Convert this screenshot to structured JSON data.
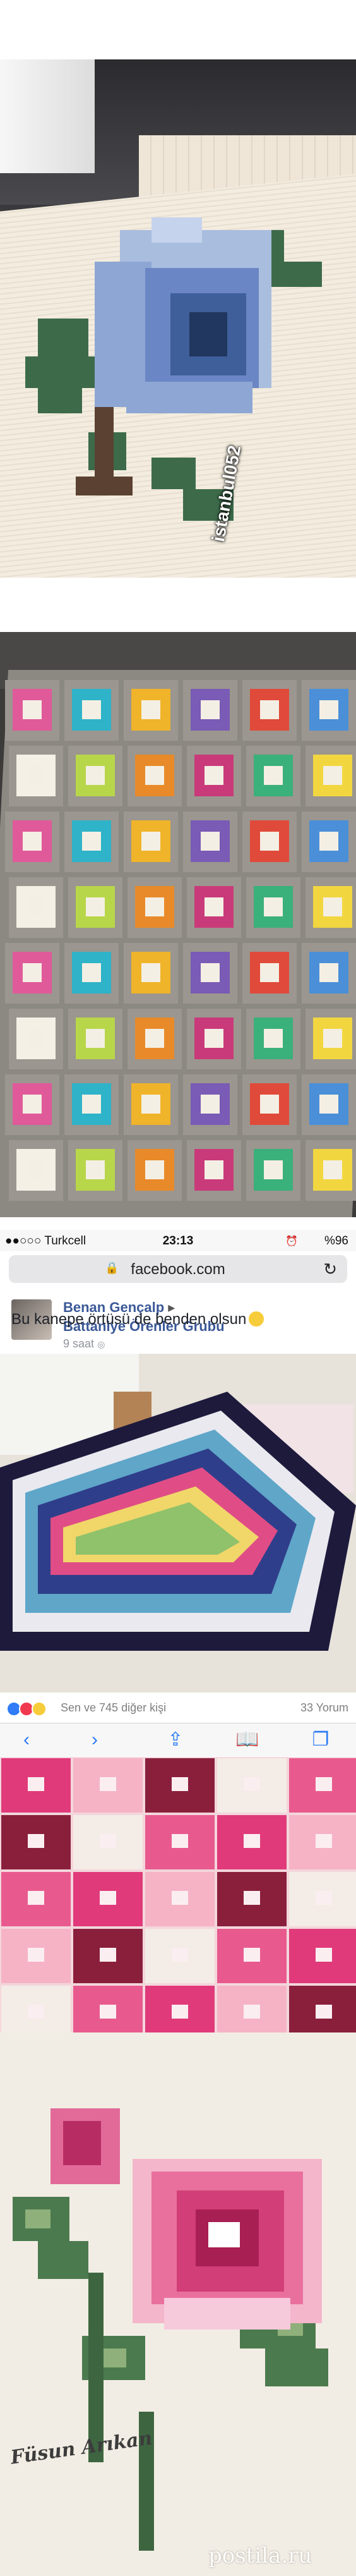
{
  "watermarks": {
    "photo1_credit": "istanbul052",
    "photo4_credit": "Füsun Arıkan",
    "site_mark": "postila.ru"
  },
  "status_bar": {
    "carrier": "●●○○○ Turkcell",
    "time": "23:13",
    "battery": "%96"
  },
  "browser": {
    "url": "facebook.com"
  },
  "post": {
    "author": "Benan Gençalp",
    "group": "Battaniye Örenler Grubu",
    "time": "9 saat",
    "text": "Bu kanepe örtüsü de benden olsun"
  },
  "engagement": {
    "reactions_text": "Sen ve 745 diğer kişi",
    "comments_text": "33 Yorum"
  },
  "icons": [
    "back-icon",
    "forward-icon",
    "share-icon",
    "bookmarks-icon",
    "tabs-icon",
    "lock-icon",
    "reload-icon",
    "globe-icon"
  ],
  "colors": {
    "link_blue": "#3b5998",
    "ios_blue": "#2f7cf6",
    "rose_blue": "#6b86c4",
    "rose_pink": "#e2407a"
  }
}
